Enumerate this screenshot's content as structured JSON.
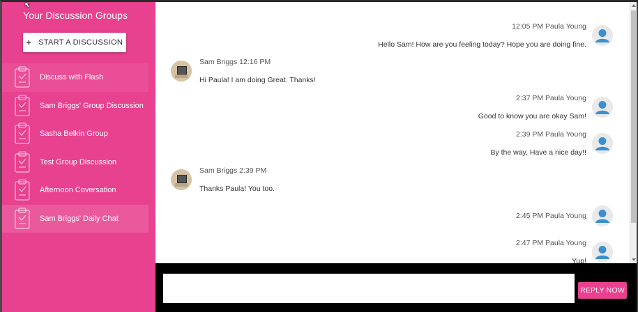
{
  "sidebar": {
    "title": "Your Discussion Groups",
    "start_button": {
      "icon": "+",
      "label": "START A DISCUSSION"
    },
    "groups": [
      {
        "label": "Discuss with Flash"
      },
      {
        "label": "Sam Briggs' Group Discussion"
      },
      {
        "label": "Sasha Belkin Group"
      },
      {
        "label": "Test Group Discussion"
      },
      {
        "label": "Afternoon Coversation"
      },
      {
        "label": "Sam Briggs' Daily Chat"
      }
    ]
  },
  "messages": [
    {
      "side": "right",
      "meta": "12:05 PM Paula Young",
      "text": "Hello Sam! How are you feeling today? Hope you are doing fine."
    },
    {
      "side": "left",
      "meta": "Sam Briggs 12:16 PM",
      "text": "Hi Paula! I am doing Great. Thanks!"
    },
    {
      "side": "right",
      "meta": "2:37 PM Paula Young",
      "text": "Good to know you are okay Sam!"
    },
    {
      "side": "right",
      "meta": "2:39 PM Paula Young",
      "text": "By the way, Have a nice day!!"
    },
    {
      "side": "left",
      "meta": "Sam Briggs 2:39 PM",
      "text": "Thanks Paula! You too."
    },
    {
      "side": "right",
      "meta": "2:45 PM Paula Young",
      "text": ""
    },
    {
      "side": "right",
      "meta": "2:47 PM Paula Young",
      "text": "Yup!"
    }
  ],
  "reply": {
    "input_value": "",
    "button_label": "REPLY NOW"
  },
  "colors": {
    "accent": "#e8418f",
    "avatar_blue": "#3a8fd1",
    "reply_bar": "#000000"
  },
  "icons": {
    "group_icon": "clipboard-icon",
    "user_avatar": "user-icon"
  }
}
